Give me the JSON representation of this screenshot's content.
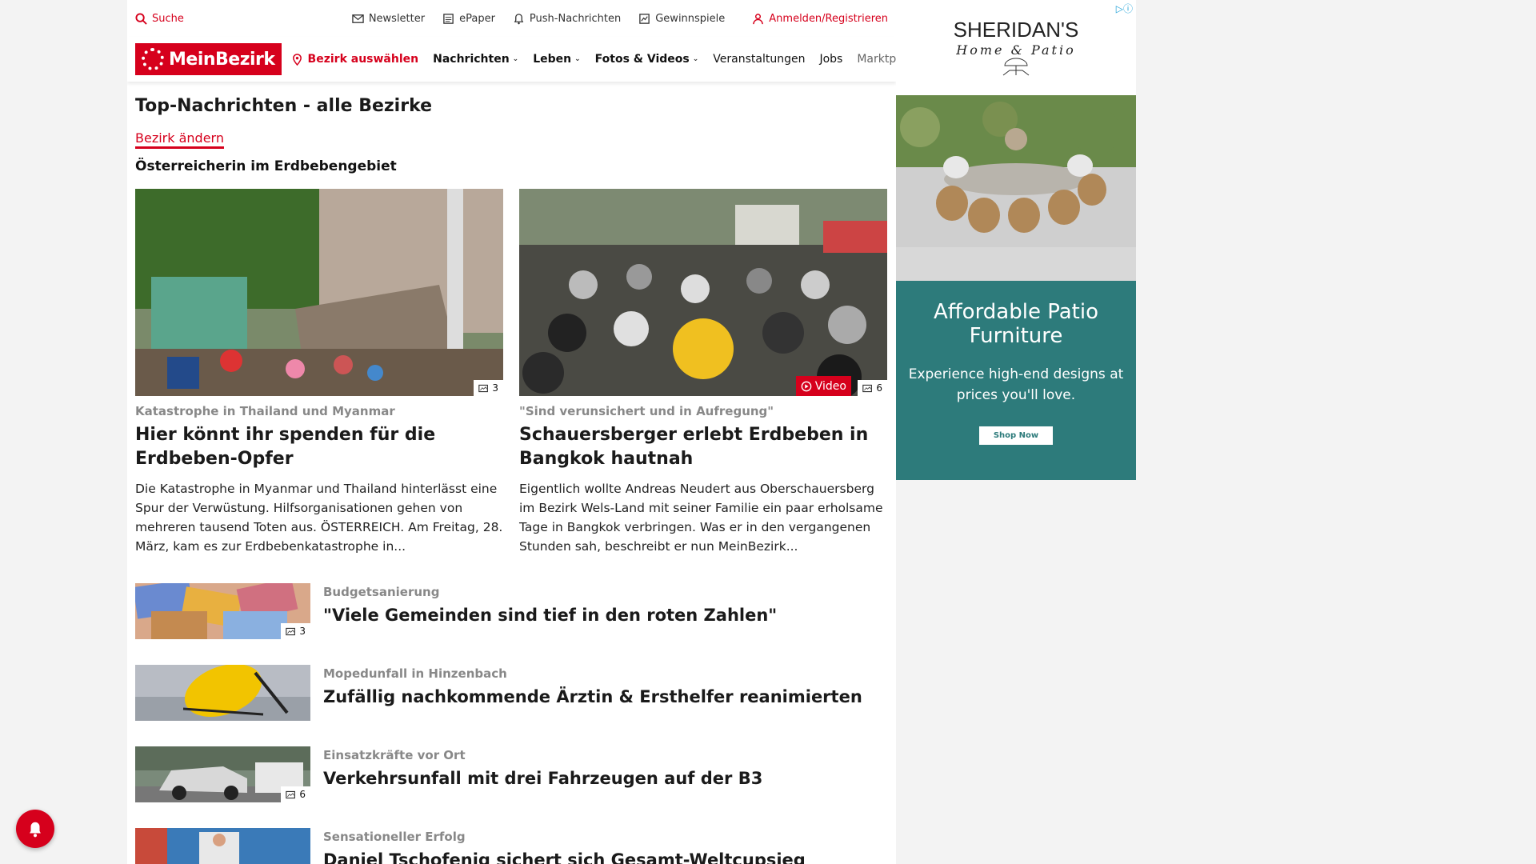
{
  "util_bar": {
    "search": "Suche",
    "newsletter": "Newsletter",
    "epaper": "ePaper",
    "push": "Push-Nachrichten",
    "gewinnspiele": "Gewinnspiele",
    "login": "Anmelden/Registrieren"
  },
  "nav": {
    "logo": "MeinBezirk",
    "bezirk": "Bezirk auswählen",
    "items": [
      "Nachrichten",
      "Leben",
      "Fotos & Videos",
      "Veranstaltungen",
      "Jobs",
      "Marktplatz"
    ]
  },
  "section": {
    "title": "Top-Nachrichten - alle Bezirke",
    "change_link": "Bezirk ändern",
    "subheading": "Österreicherin im Erdbebengebiet"
  },
  "featured": [
    {
      "kicker": "Katastrophe in Thailand und Myanmar",
      "title": "Hier könnt ihr spenden für die Erdbeben-Opfer",
      "teaser": "Die Katastrophe in Myanmar und Thailand hinterlässt eine Spur der Verwüstung. Hilfsorganisationen gehen von mehreren tausend Toten aus.  ÖSTERREICH. Am Freitag, 28. März, kam es zur Erdbebenkatastrophe in...",
      "photo_count": "3"
    },
    {
      "kicker": "\"Sind verunsichert und in Aufregung\"",
      "title": "Schauersberger erlebt Erdbeben in Bangkok hautnah",
      "teaser": "Eigentlich wollte Andreas Neudert aus Oberschauersberg im Bezirk Wels-Land mit seiner Familie ein paar erholsame Tage in Bangkok verbringen. Was er in den vergangenen Stunden sah, beschreibt er nun MeinBezirk...",
      "video_label": "Video",
      "photo_count": "6"
    }
  ],
  "list": [
    {
      "kicker": "Budgetsanierung",
      "title": "\"Viele Gemeinden sind tief in den roten Zahlen\"",
      "photo_count": "3"
    },
    {
      "kicker": "Mopedunfall in Hinzenbach",
      "title": "Zufällig nachkommende Ärztin & Ersthelfer reanimierten",
      "photo_count": ""
    },
    {
      "kicker": "Einsatzkräfte vor Ort",
      "title": "Verkehrsunfall mit drei Fahrzeugen auf der B3",
      "photo_count": "6"
    },
    {
      "kicker": "Sensationeller Erfolg",
      "title": "Daniel Tschofenig sichert sich Gesamt-Weltcupsieg",
      "photo_count": ""
    }
  ],
  "ad": {
    "brand": "SHERIDAN'S",
    "brand_sub": "Home & Patio",
    "headline": "Affordable Patio Furniture",
    "body": "Experience high-end designs at prices you'll love.",
    "cta": "Shop Now"
  },
  "colors": {
    "accent": "#d6001c",
    "ad_teal": "#2d7b7b"
  }
}
